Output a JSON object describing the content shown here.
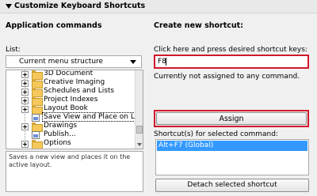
{
  "header": {
    "title": "Customize Keyboard Shortcuts"
  },
  "left": {
    "heading": "Application commands",
    "list_label": "List:",
    "list_select": "Current menu structure",
    "tree": [
      {
        "label": "3D Document",
        "icon": "folder-icon",
        "expandable": true
      },
      {
        "label": "Creative Imaging",
        "icon": "folder-icon",
        "expandable": true
      },
      {
        "label": "Schedules and Lists",
        "icon": "folder-icon",
        "expandable": true
      },
      {
        "label": "Project Indexes",
        "icon": "folder-icon",
        "expandable": true
      },
      {
        "label": "Layout Book",
        "icon": "folder-icon",
        "expandable": true
      },
      {
        "label": "Save View and Place on Layout",
        "icon": "document-icon",
        "expandable": false,
        "selected": true
      },
      {
        "label": "Drawings",
        "icon": "folder-icon",
        "expandable": true
      },
      {
        "label": "Publish...",
        "icon": "publish-icon",
        "expandable": false
      },
      {
        "label": "Options",
        "icon": "folder-icon",
        "expandable": true
      }
    ],
    "description": "Saves a new view and places it on the active layout."
  },
  "right": {
    "heading": "Create new shortcut:",
    "instruction": "Click here and press desired shortcut keys:",
    "shortcut_value": "F8",
    "status": "Currently not assigned to any command.",
    "assign_label": "Assign",
    "shortcuts_label": "Shortcut(s) for selected command:",
    "shortcuts": [
      "Alt+F7 (Global)"
    ],
    "detach_label": "Detach selected shortcut"
  },
  "colors": {
    "highlight": "#d0182a",
    "selection": "#3399ff"
  }
}
